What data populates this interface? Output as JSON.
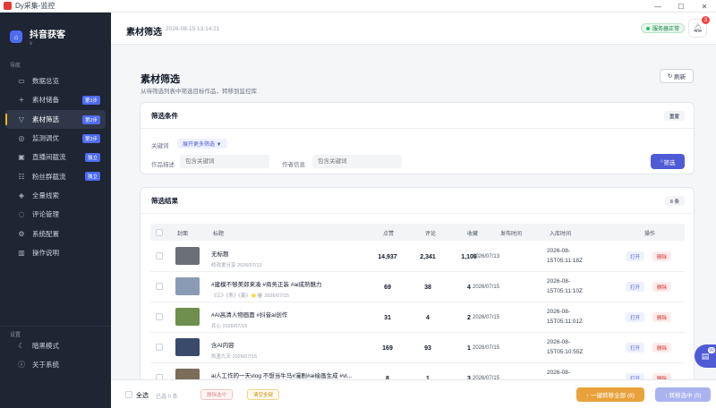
{
  "window": {
    "title": "Dy采集-监控"
  },
  "sidebar": {
    "brand_name": "抖音获客",
    "brand_sub": "v",
    "nav_heading": "导航",
    "items": [
      {
        "label": "数据总览",
        "icon": "dashboard-icon",
        "badge": ""
      },
      {
        "label": "素材储备",
        "icon": "plus-icon",
        "badge": "第1步"
      },
      {
        "label": "素材筛选",
        "icon": "filter-icon",
        "badge": "第2步",
        "active": true
      },
      {
        "label": "监测调优",
        "icon": "compass-icon",
        "badge": "第3步"
      },
      {
        "label": "直播间截流",
        "icon": "live-icon",
        "badge": "独立"
      },
      {
        "label": "粉丝群截流",
        "icon": "group-icon",
        "badge": "独立"
      },
      {
        "label": "全量线索",
        "icon": "leads-icon",
        "badge": ""
      },
      {
        "label": "评论管理",
        "icon": "comment-icon",
        "badge": ""
      },
      {
        "label": "系统配置",
        "icon": "gear-icon",
        "badge": ""
      },
      {
        "label": "操作说明",
        "icon": "book-icon",
        "badge": ""
      }
    ],
    "settings_heading": "设置",
    "settings_items": [
      {
        "label": "暗黑模式",
        "icon": "moon-icon"
      },
      {
        "label": "关于系统",
        "icon": "info-icon"
      }
    ]
  },
  "header": {
    "title": "素材筛选",
    "timestamp": "2026-08-15 13:14:21",
    "status": "服务器正常",
    "notifications": "3"
  },
  "main": {
    "title": "素材筛选",
    "description": "从待筛选列表中筛选目标作品，转移到监控库",
    "refresh_label": "刷新",
    "filter": {
      "title": "筛选条件",
      "reset_label": "重置",
      "keyword_label": "关键词",
      "expand_label": "展开更多筛选 ▼",
      "desc_label": "作品描述",
      "desc_placeholder": "包含关键词",
      "author_label": "作者信息",
      "author_placeholder": "包含关键词",
      "submit_label": "筛选"
    },
    "results": {
      "title": "筛选结果",
      "count_label": "8 条",
      "columns": [
        "封面",
        "标题",
        "点赞",
        "评论",
        "收藏",
        "发布时间",
        "入库时间",
        "操作"
      ],
      "rows": [
        {
          "title": "无标题",
          "author": "修改爱分享",
          "pub": "2026/07/13",
          "likes": "14,937",
          "comments": "2,341",
          "favs": "1,109",
          "date": "2026/07/13",
          "stored_1": "2026-08-",
          "stored_2": "15T05:11:18Z"
        },
        {
          "title": "#建模不够美郎来凑 #商务正装 #ai成熟魅力",
          "author": "《江》《荼》《姜》⭐🏵",
          "pub": "2026/07/15",
          "likes": "69",
          "comments": "38",
          "favs": "4",
          "date": "2026/07/15",
          "stored_1": "2026-08-",
          "stored_2": "15T05:11:10Z"
        },
        {
          "title": "#AI高清人物画面 #抖音ai创作",
          "author": "兵心",
          "pub": "2026/07/15",
          "likes": "31",
          "comments": "4",
          "favs": "2",
          "date": "2026/07/15",
          "stored_1": "2026-08-",
          "stored_2": "15T05:11:01Z"
        },
        {
          "title": "含AI内容",
          "author": "凯墨九天",
          "pub": "2026/07/15",
          "likes": "169",
          "comments": "93",
          "favs": "1",
          "date": "2026/07/15",
          "stored_1": "2026-08-",
          "stored_2": "15T05:10:55Z"
        },
        {
          "title": "ai人工作的一天vlog 不想当牛马#漫剧#ai绘画生成 #vl...",
          "author": "",
          "pub": "",
          "likes": "8",
          "comments": "1",
          "favs": "3",
          "date": "2026/07/15",
          "stored_1": "2026-08-",
          "stored_2": ""
        }
      ],
      "open_label": "打开",
      "delete_label": "删除"
    }
  },
  "bottom_bar": {
    "select_all": "全选",
    "selected_count": "已选 0 条",
    "delete_selected": "删除选中",
    "clear_all": "清空全部",
    "one_click_transfer": "↑ 一键转移全部 (8)",
    "transfer_selected": "↑ 转移选中 (0)"
  },
  "floating": {
    "badge": "99"
  },
  "colors": {
    "accent": "#4f5bd5",
    "sidebar_bg": "#1e2533",
    "orange": "#e9a23b",
    "success": "#22c55e",
    "danger": "#ef4444"
  }
}
